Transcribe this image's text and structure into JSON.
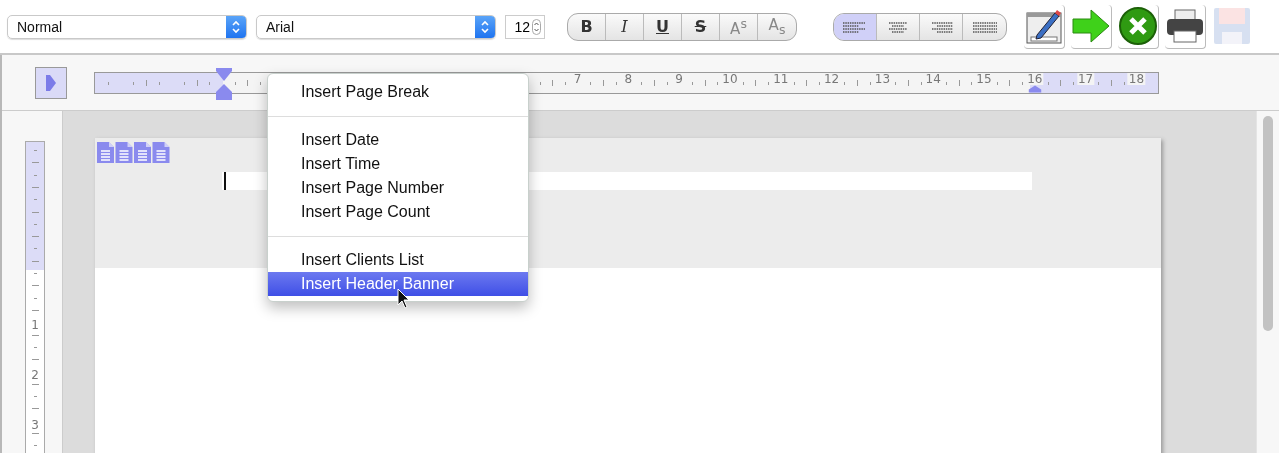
{
  "toolbar": {
    "style_select": {
      "value": "Normal"
    },
    "font_select": {
      "value": "Arial"
    },
    "size_field": {
      "value": "12"
    },
    "format_buttons": [
      {
        "kind": "bold",
        "label": "B",
        "selected": false
      },
      {
        "kind": "italic",
        "label": "I",
        "selected": false
      },
      {
        "kind": "underline",
        "label": "U",
        "selected": false
      },
      {
        "kind": "strike",
        "label": "S",
        "selected": false
      },
      {
        "kind": "superscript",
        "label": "A$^{s}$",
        "selected": false
      },
      {
        "kind": "subscript",
        "label": "A$_{s}$",
        "selected": false
      }
    ],
    "align_buttons": [
      {
        "kind": "left",
        "selected": true
      },
      {
        "kind": "center",
        "selected": false
      },
      {
        "kind": "right",
        "selected": false
      },
      {
        "kind": "justify",
        "selected": false
      }
    ],
    "tools": [
      {
        "kind": "edit",
        "disabled": false
      },
      {
        "kind": "next",
        "disabled": false
      },
      {
        "kind": "cancel",
        "disabled": false
      },
      {
        "kind": "print",
        "disabled": false
      },
      {
        "kind": "save",
        "disabled": true
      }
    ]
  },
  "ruler": {
    "labels": [
      "7",
      "8",
      "9",
      "10",
      "11",
      "12",
      "13",
      "14",
      "15",
      "16",
      "17",
      "18"
    ]
  },
  "vertical_ruler": {
    "labels": [
      "1",
      "2",
      "3"
    ]
  },
  "context_menu": {
    "groups": [
      [
        {
          "label": "Insert Page Break",
          "selected": false
        }
      ],
      [
        {
          "label": "Insert Date",
          "selected": false
        },
        {
          "label": "Insert Time",
          "selected": false
        },
        {
          "label": "Insert Page Number",
          "selected": false
        },
        {
          "label": "Insert Page Count",
          "selected": false
        }
      ],
      [
        {
          "label": "Insert Clients List",
          "selected": false
        },
        {
          "label": "Insert Header Banner",
          "selected": true
        }
      ]
    ]
  }
}
